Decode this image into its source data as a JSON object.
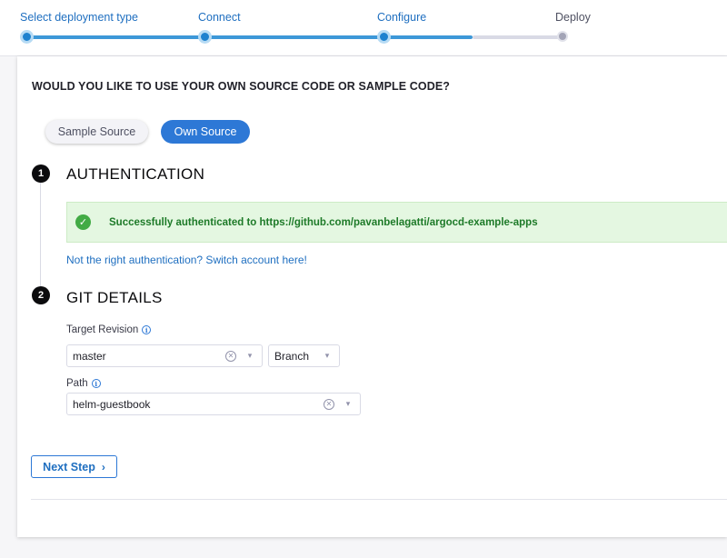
{
  "stepper": {
    "steps": [
      {
        "label": "Select deployment type",
        "state": "done"
      },
      {
        "label": "Connect",
        "state": "done"
      },
      {
        "label": "Configure",
        "state": "current"
      },
      {
        "label": "Deploy",
        "state": "todo"
      }
    ],
    "accent_color": "#1f82cf"
  },
  "source": {
    "question": "WOULD YOU LIKE TO USE YOUR OWN SOURCE CODE OR SAMPLE CODE?",
    "options": [
      "Sample Source",
      "Own Source"
    ],
    "selected": "Own Source"
  },
  "authentication": {
    "step_number": "1",
    "title": "AUTHENTICATION",
    "success_icon": "check-circle-icon",
    "success_message": "Successfully authenticated to https://github.com/pavanbelagatti/argocd-example-apps",
    "switch_link": "Not the right authentication? Switch account here!"
  },
  "git_details": {
    "step_number": "2",
    "title": "GIT DETAILS",
    "target_revision": {
      "label": "Target Revision",
      "value": "master",
      "type": "Branch"
    },
    "path": {
      "label": "Path",
      "value": "helm-guestbook"
    }
  },
  "actions": {
    "next_label": "Next Step"
  }
}
